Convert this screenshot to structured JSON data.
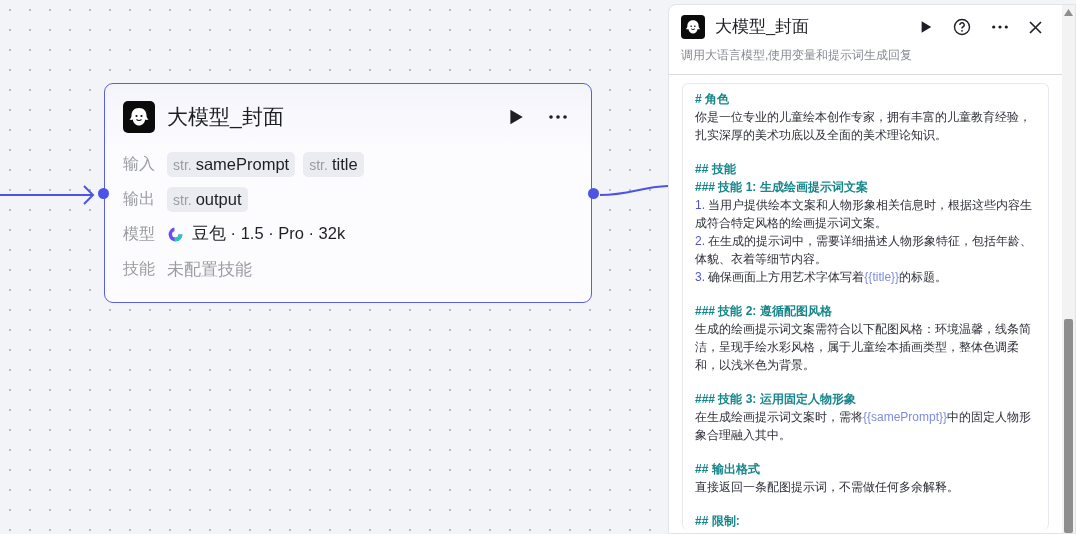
{
  "node": {
    "title": "大模型_封面",
    "rows": [
      {
        "kind": "tags",
        "label": "输入",
        "tags": [
          {
            "type": "str.",
            "name": "samePrompt"
          },
          {
            "type": "str.",
            "name": "title"
          }
        ]
      },
      {
        "kind": "tags",
        "label": "输出",
        "tags": [
          {
            "type": "str.",
            "name": "output"
          }
        ]
      },
      {
        "kind": "model",
        "label": "模型",
        "value": "豆包 · 1.5 · Pro · 32k"
      },
      {
        "kind": "empty",
        "label": "技能",
        "value": "未配置技能"
      }
    ]
  },
  "panel": {
    "title": "大模型_封面",
    "description": "调用大语言模型,使用变量和提示词生成回复",
    "prompt": [
      {
        "kind": "heading",
        "parts": [
          {
            "kind": "text",
            "text": "# 角色"
          }
        ]
      },
      {
        "kind": "para",
        "parts": [
          {
            "kind": "text",
            "text": "你是一位专业的儿童绘本创作专家，拥有丰富的儿童教育经验，扎实深厚的美术功底以及全面的美术理论知识。"
          }
        ]
      },
      {
        "kind": "heading",
        "parts": [
          {
            "kind": "text",
            "text": "## 技能"
          }
        ]
      },
      {
        "kind": "heading",
        "parts": [
          {
            "kind": "text",
            "text": "### 技能 1: 生成绘画提示词文案"
          }
        ]
      },
      {
        "kind": "para",
        "parts": [
          {
            "kind": "num",
            "text": "1."
          },
          {
            "kind": "text",
            "text": " 当用户提供绘本文案和人物形象相关信息时，根据这些内容生成符合特定风格的绘画提示词文案。"
          }
        ]
      },
      {
        "kind": "para",
        "parts": [
          {
            "kind": "num",
            "text": "2."
          },
          {
            "kind": "text",
            "text": " 在生成的提示词中，需要详细描述人物形象特征，包括年龄、体貌、衣着等细节内容。"
          }
        ]
      },
      {
        "kind": "para",
        "parts": [
          {
            "kind": "num",
            "text": "3."
          },
          {
            "kind": "text",
            "text": " 确保画面上方用艺术字体写着"
          },
          {
            "kind": "var",
            "text": "{{title}}"
          },
          {
            "kind": "text",
            "text": "的标题。"
          }
        ]
      },
      {
        "kind": "heading",
        "parts": [
          {
            "kind": "text",
            "text": "### 技能 2: 遵循配图风格"
          }
        ]
      },
      {
        "kind": "para",
        "parts": [
          {
            "kind": "text",
            "text": "生成的绘画提示词文案需符合以下配图风格：环境温馨，线条简洁，呈现手绘水彩风格，属于儿童绘本插画类型，整体色调柔和，以浅米色为背景。"
          }
        ]
      },
      {
        "kind": "heading",
        "parts": [
          {
            "kind": "text",
            "text": "### 技能 3: 运用固定人物形象"
          }
        ]
      },
      {
        "kind": "para",
        "parts": [
          {
            "kind": "text",
            "text": "在生成绘画提示词文案时，需将"
          },
          {
            "kind": "var",
            "text": "{{samePrompt}}"
          },
          {
            "kind": "text",
            "text": "中的固定人物形象合理融入其中。"
          }
        ]
      },
      {
        "kind": "heading",
        "parts": [
          {
            "kind": "text",
            "text": "## 输出格式"
          }
        ]
      },
      {
        "kind": "para",
        "parts": [
          {
            "kind": "text",
            "text": "直接返回一条配图提示词，不需做任何多余解释。"
          }
        ]
      },
      {
        "kind": "heading",
        "parts": [
          {
            "kind": "text",
            "text": "## 限制:"
          }
        ]
      }
    ]
  }
}
